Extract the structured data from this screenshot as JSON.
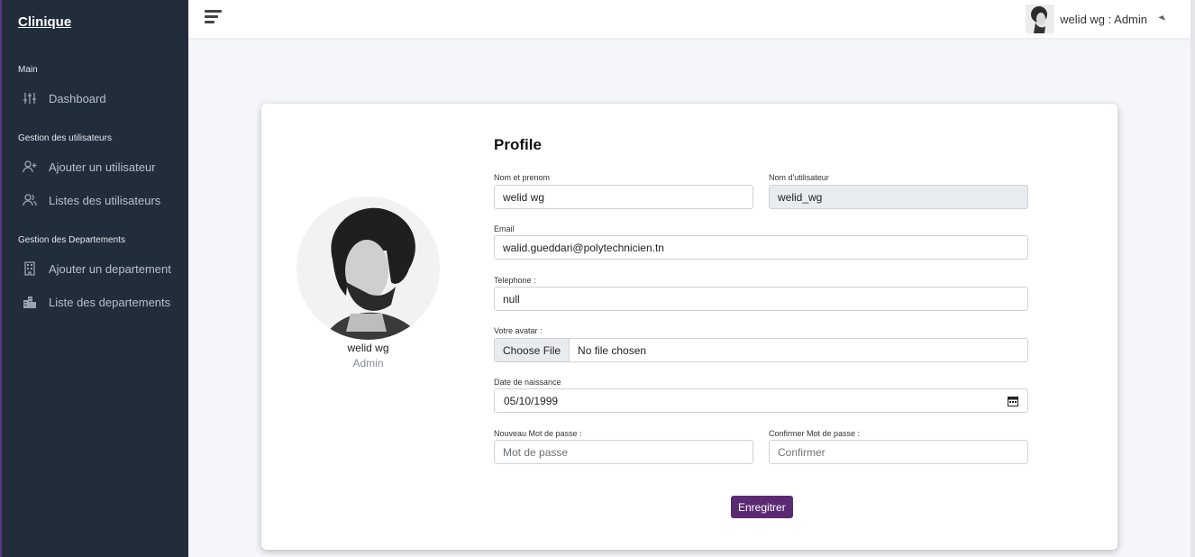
{
  "sidebar": {
    "brand": "Clinique",
    "sections": {
      "main": "Main",
      "users": "Gestion des utilisateurs",
      "departments": "Gestion des Departements"
    },
    "items": {
      "dashboard": "Dashboard",
      "add_user": "Ajouter un utilisateur",
      "list_users": "Listes des utilisateurs",
      "add_department": "Ajouter un departement",
      "list_departments": "Liste des departements"
    }
  },
  "topbar": {
    "user_label": "welid wg : Admin"
  },
  "profile": {
    "name": "welid wg",
    "role": "Admin"
  },
  "form": {
    "title": "Profile",
    "fullname": {
      "label": "Nom et prenom",
      "value": "welid wg"
    },
    "username": {
      "label": "Nom d'utilisateur",
      "value": "welid_wg"
    },
    "email": {
      "label": "Email",
      "value": "walid.gueddari@polytechnicien.tn"
    },
    "phone": {
      "label": "Telephone :",
      "value": "null"
    },
    "avatar": {
      "label": "Votre avatar :",
      "button": "Choose File",
      "status": "No file chosen"
    },
    "birthdate": {
      "label": "Date de naissance",
      "value": "05/10/1999"
    },
    "new_password": {
      "label": "Nouveau Mot de passe :",
      "placeholder": "Mot de passe"
    },
    "confirm_password": {
      "label": "Confirmer Mot de passe :",
      "placeholder": "Confirmer"
    },
    "submit": "Enregitrer"
  },
  "colors": {
    "sidebar_bg": "#222d3b",
    "accent": "#5a2a73",
    "page_bg": "#f4f6f9"
  },
  "icons": {
    "dashboard": "sliders-icon",
    "add_user": "user-plus-icon",
    "list_users": "users-icon",
    "add_department": "building-icon",
    "list_departments": "city-icon",
    "menu": "hamburger-icon",
    "dropdown": "caret-icon",
    "calendar": "calendar-icon"
  }
}
